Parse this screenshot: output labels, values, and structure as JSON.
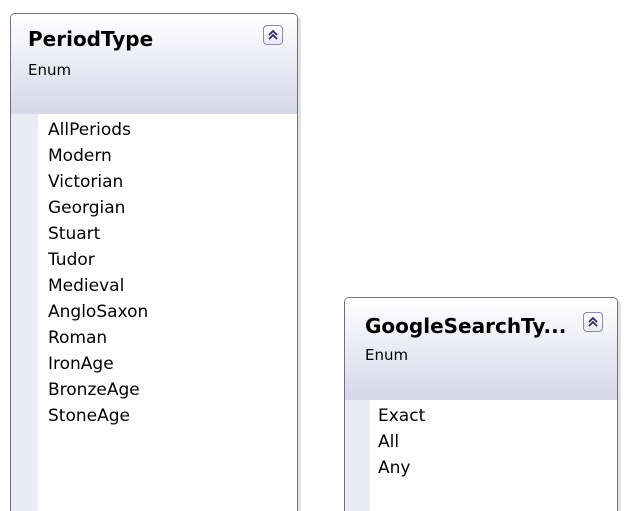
{
  "enums": [
    {
      "name": "PeriodType",
      "stereotype": "Enum",
      "collapse_icon": "double-chevron-up-icon",
      "members": [
        "AllPeriods",
        "Modern",
        "Victorian",
        "Georgian",
        "Stuart",
        "Tudor",
        "Medieval",
        "AngloSaxon",
        "Roman",
        "IronAge",
        "BronzeAge",
        "StoneAge"
      ]
    },
    {
      "name": "GoogleSearchTy...",
      "stereotype": "Enum",
      "collapse_icon": "double-chevron-up-icon",
      "members": [
        "Exact",
        "All",
        "Any"
      ]
    }
  ],
  "colors": {
    "border": "#6e6e8a",
    "header_gradient_start": "#ffffff",
    "header_gradient_end": "#d6d6ea",
    "compartment_strip": "#ebebf3",
    "text": "#000000"
  }
}
